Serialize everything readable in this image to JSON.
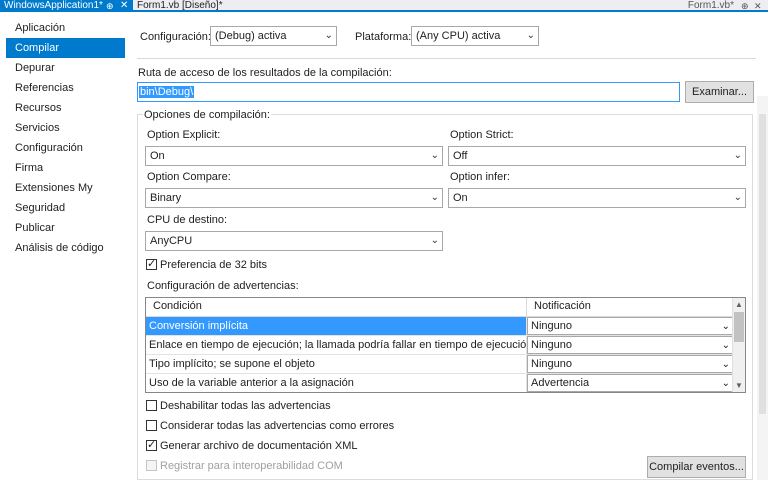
{
  "tabs": {
    "active_label": "WindowsApplication1*",
    "pin_glyph": "⊕",
    "close_glyph": "✕",
    "second_label": "Form1.vb [Diseño]*",
    "right_label": "Form1.vb*",
    "right_pin": "⊕",
    "right_close": "✕"
  },
  "sidebar": {
    "items": [
      {
        "label": "Aplicación"
      },
      {
        "label": "Compilar"
      },
      {
        "label": "Depurar"
      },
      {
        "label": "Referencias"
      },
      {
        "label": "Recursos"
      },
      {
        "label": "Servicios"
      },
      {
        "label": "Configuración"
      },
      {
        "label": "Firma"
      },
      {
        "label": "Extensiones My"
      },
      {
        "label": "Seguridad"
      },
      {
        "label": "Publicar"
      },
      {
        "label": "Análisis de código"
      }
    ],
    "active": "Compilar"
  },
  "header": {
    "config_label": "Configuración:",
    "config_value": "(Debug) activa",
    "platform_label": "Plataforma:",
    "platform_value": "(Any CPU) activa"
  },
  "output_path": {
    "label": "Ruta de acceso de los resultados de la compilación:",
    "value": "bin\\Debug\\",
    "browse_button": "Examinar..."
  },
  "compile_options": {
    "group_label": "Opciones de compilación:",
    "option_explicit_label": "Option Explicit:",
    "option_explicit_value": "On",
    "option_strict_label": "Option Strict:",
    "option_strict_value": "Off",
    "option_compare_label": "Option Compare:",
    "option_compare_value": "Binary",
    "option_infer_label": "Option infer:",
    "option_infer_value": "On",
    "target_cpu_label": "CPU de destino:",
    "target_cpu_value": "AnyCPU",
    "prefer32_label": "Preferencia de 32 bits",
    "prefer32_checked": true
  },
  "warnings": {
    "label": "Configuración de advertencias:",
    "col_condition": "Condición",
    "col_notification": "Notificación",
    "rows": [
      {
        "condition": "Conversión implícita",
        "notification": "Ninguno"
      },
      {
        "condition": "Enlace en tiempo de ejecución; la llamada podría fallar en tiempo de ejecución",
        "notification": "Ninguno"
      },
      {
        "condition": "Tipo implícito; se supone el objeto",
        "notification": "Ninguno"
      },
      {
        "condition": "Uso de la variable anterior a la asignación",
        "notification": "Advertencia"
      }
    ],
    "selected_row": 0
  },
  "checkboxes": {
    "disable_all": "Deshabilitar todas las advertencias",
    "treat_as_errors": "Considerar todas las advertencias como errores",
    "xml_doc": "Generar archivo de documentación XML",
    "com_interop": "Registrar para interoperabilidad COM",
    "xml_doc_checked": true
  },
  "build_events_button": "Compilar eventos...",
  "icons": {
    "dropdown_arrow": "⌄",
    "check": "✓",
    "scroll_up": "▲",
    "scroll_down": "▼"
  }
}
